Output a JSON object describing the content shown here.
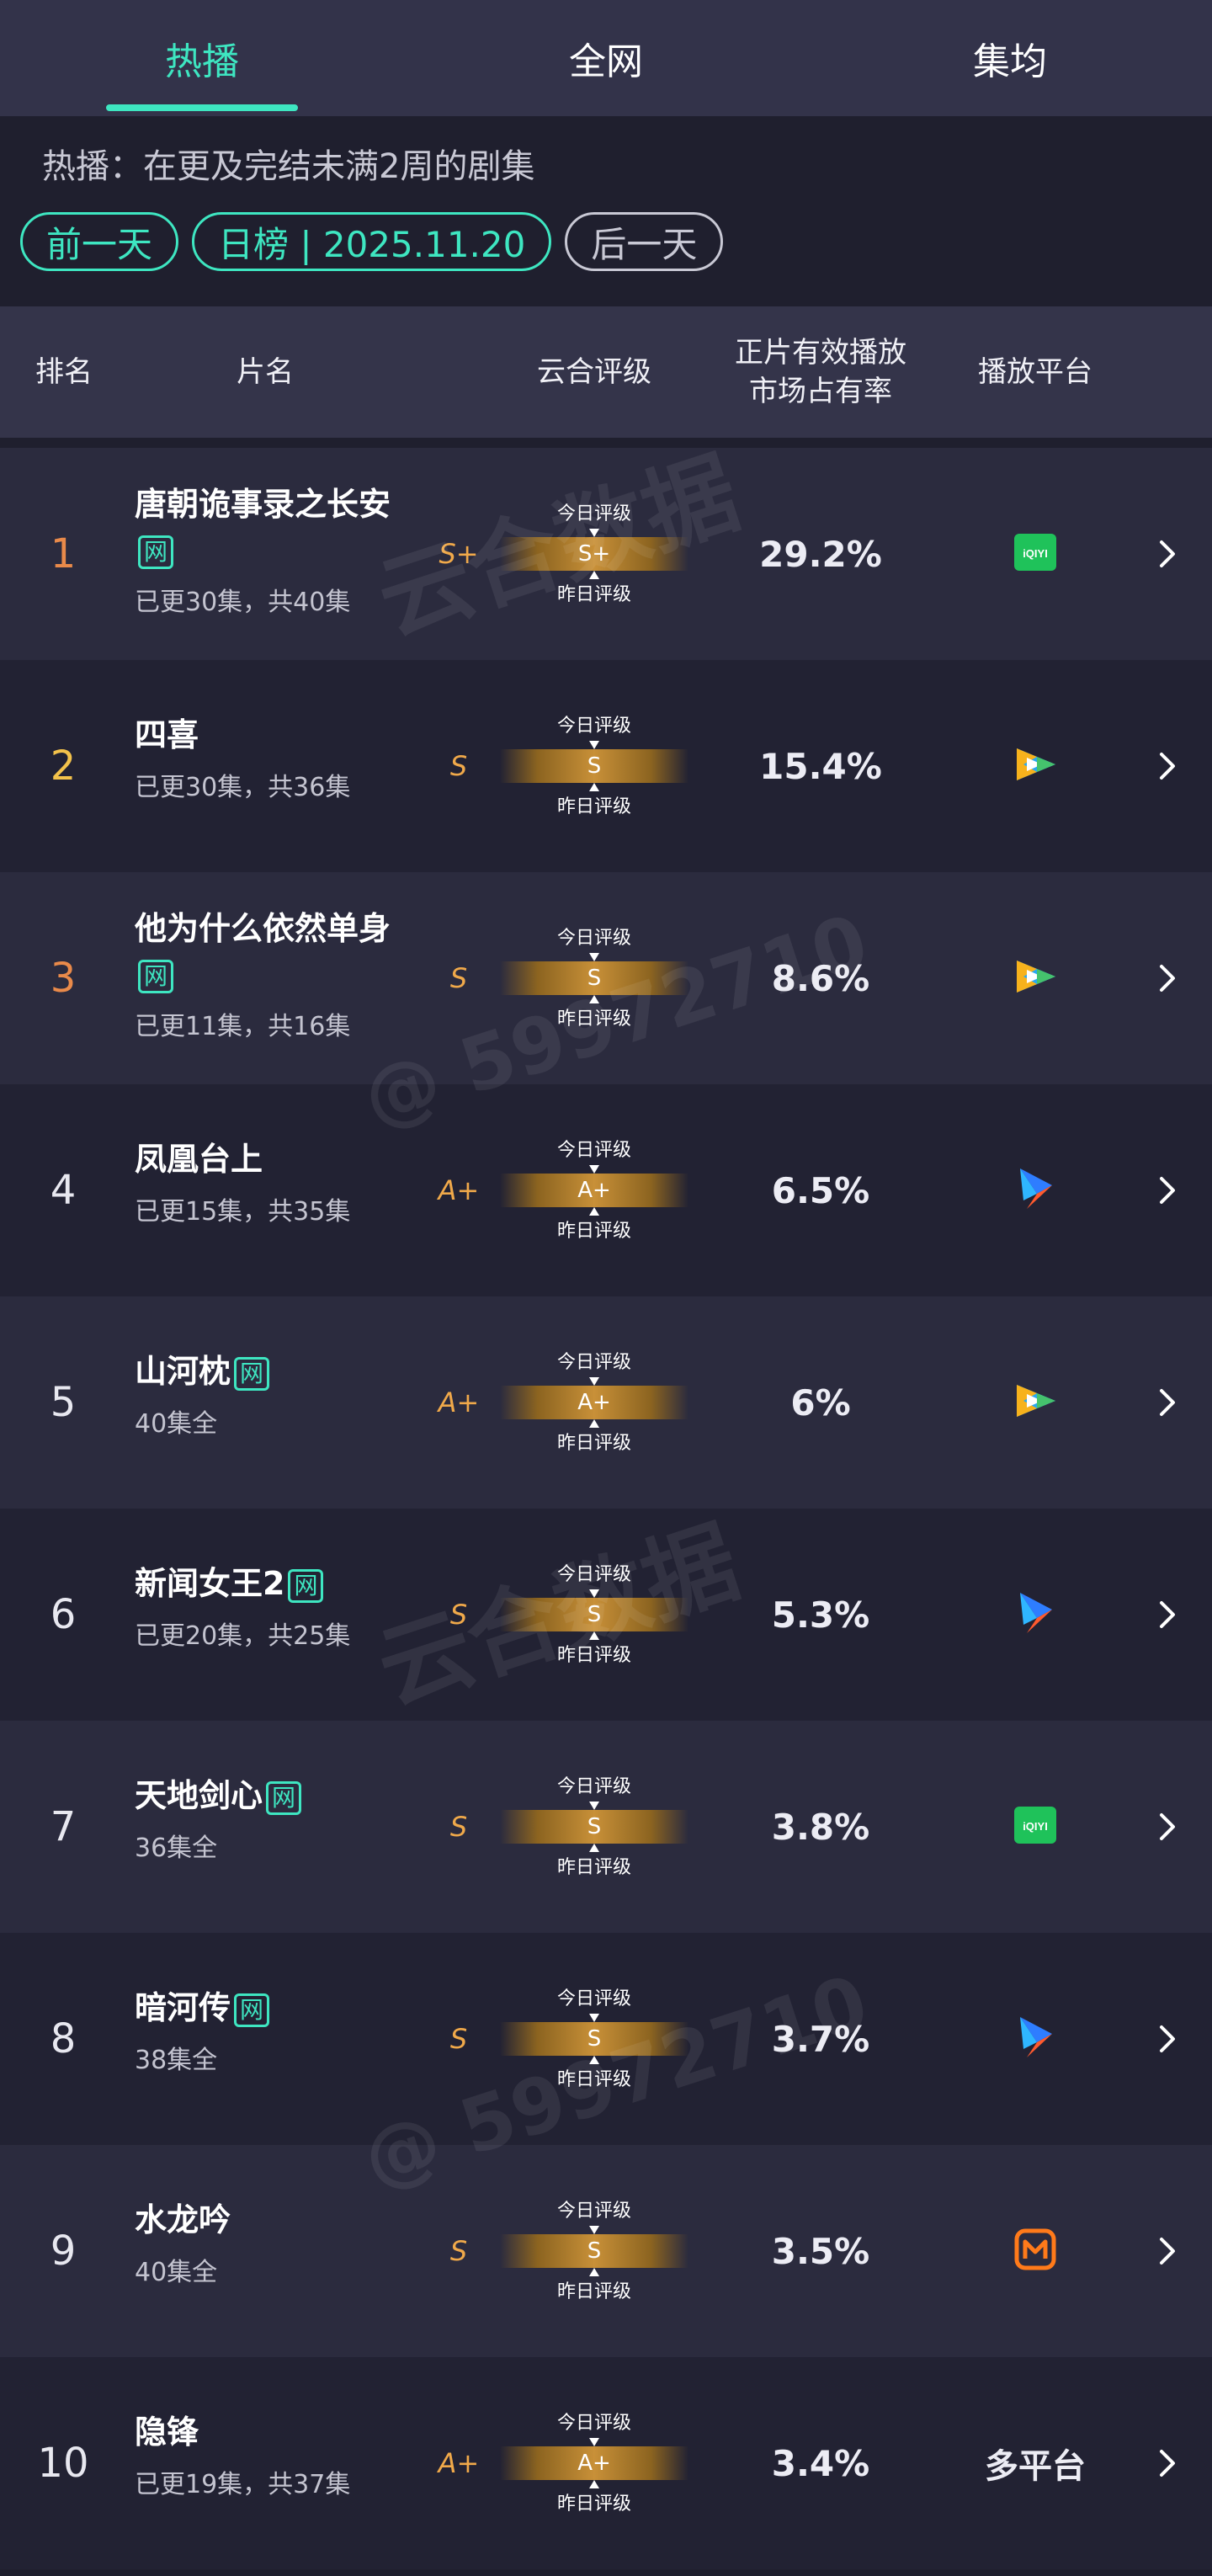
{
  "tabs": [
    {
      "label": "热播",
      "active": true
    },
    {
      "label": "全网",
      "active": false
    },
    {
      "label": "集均",
      "active": false
    }
  ],
  "subtitle": "热播：在更及完结未满2周的剧集",
  "date_nav": {
    "prev_label": "前一天",
    "current_label": "日榜 | 2025.11.20",
    "next_label": "后一天"
  },
  "table_header": {
    "rank": "排名",
    "title": "片名",
    "grade": "云合评级",
    "share_line1": "正片有效播放",
    "share_line2": "市场占有率",
    "platform": "播放平台"
  },
  "gauge_labels": {
    "today": "今日评级",
    "yesterday": "昨日评级"
  },
  "net_badge": "网",
  "watermark": {
    "text1": "云合数据",
    "text2": "@ 59972710"
  },
  "colors": {
    "accent": "#3ee6c1",
    "grade": "#f0a94a",
    "gold_rank": "#f3c24b",
    "bronze_rank": "#e98a4a",
    "iqiyi": "#1fc25a",
    "mango": "#ff7a1a"
  },
  "rows": [
    {
      "rank": "1",
      "title": "唐朝诡事录之长安",
      "net": true,
      "eps": "已更30集，共40集",
      "grade_y": "S+",
      "grade_t": "S+",
      "share": "29.2%",
      "platform": "iqiyi-icon"
    },
    {
      "rank": "2",
      "title": "四喜",
      "net": false,
      "eps": "已更30集，共36集",
      "grade_y": "S",
      "grade_t": "S",
      "share": "15.4%",
      "platform": "tencent-video-icon"
    },
    {
      "rank": "3",
      "title": "他为什么依然单身",
      "net": true,
      "eps": "已更11集，共16集",
      "grade_y": "S",
      "grade_t": "S",
      "share": "8.6%",
      "platform": "tencent-video-icon"
    },
    {
      "rank": "4",
      "title": "凤凰台上",
      "net": false,
      "eps": "已更15集，共35集",
      "grade_y": "A+",
      "grade_t": "A+",
      "share": "6.5%",
      "platform": "youku-icon"
    },
    {
      "rank": "5",
      "title": "山河枕",
      "net": true,
      "eps": "40集全",
      "grade_y": "A+",
      "grade_t": "A+",
      "share": "6%",
      "platform": "tencent-video-icon"
    },
    {
      "rank": "6",
      "title": "新闻女王2",
      "net": true,
      "eps": "已更20集，共25集",
      "grade_y": "S",
      "grade_t": "S",
      "share": "5.3%",
      "platform": "youku-icon"
    },
    {
      "rank": "7",
      "title": "天地剑心",
      "net": true,
      "eps": "36集全",
      "grade_y": "S",
      "grade_t": "S",
      "share": "3.8%",
      "platform": "iqiyi-icon"
    },
    {
      "rank": "8",
      "title": "暗河传",
      "net": true,
      "eps": "38集全",
      "grade_y": "S",
      "grade_t": "S",
      "share": "3.7%",
      "platform": "youku-icon"
    },
    {
      "rank": "9",
      "title": "水龙吟",
      "net": false,
      "eps": "40集全",
      "grade_y": "S",
      "grade_t": "S",
      "share": "3.5%",
      "platform": "mango-tv-icon"
    },
    {
      "rank": "10",
      "title": "隐锋",
      "net": false,
      "eps": "已更19集，共37集",
      "grade_y": "A+",
      "grade_t": "A+",
      "share": "3.4%",
      "platform": "multi",
      "platform_text": "多平台"
    }
  ]
}
